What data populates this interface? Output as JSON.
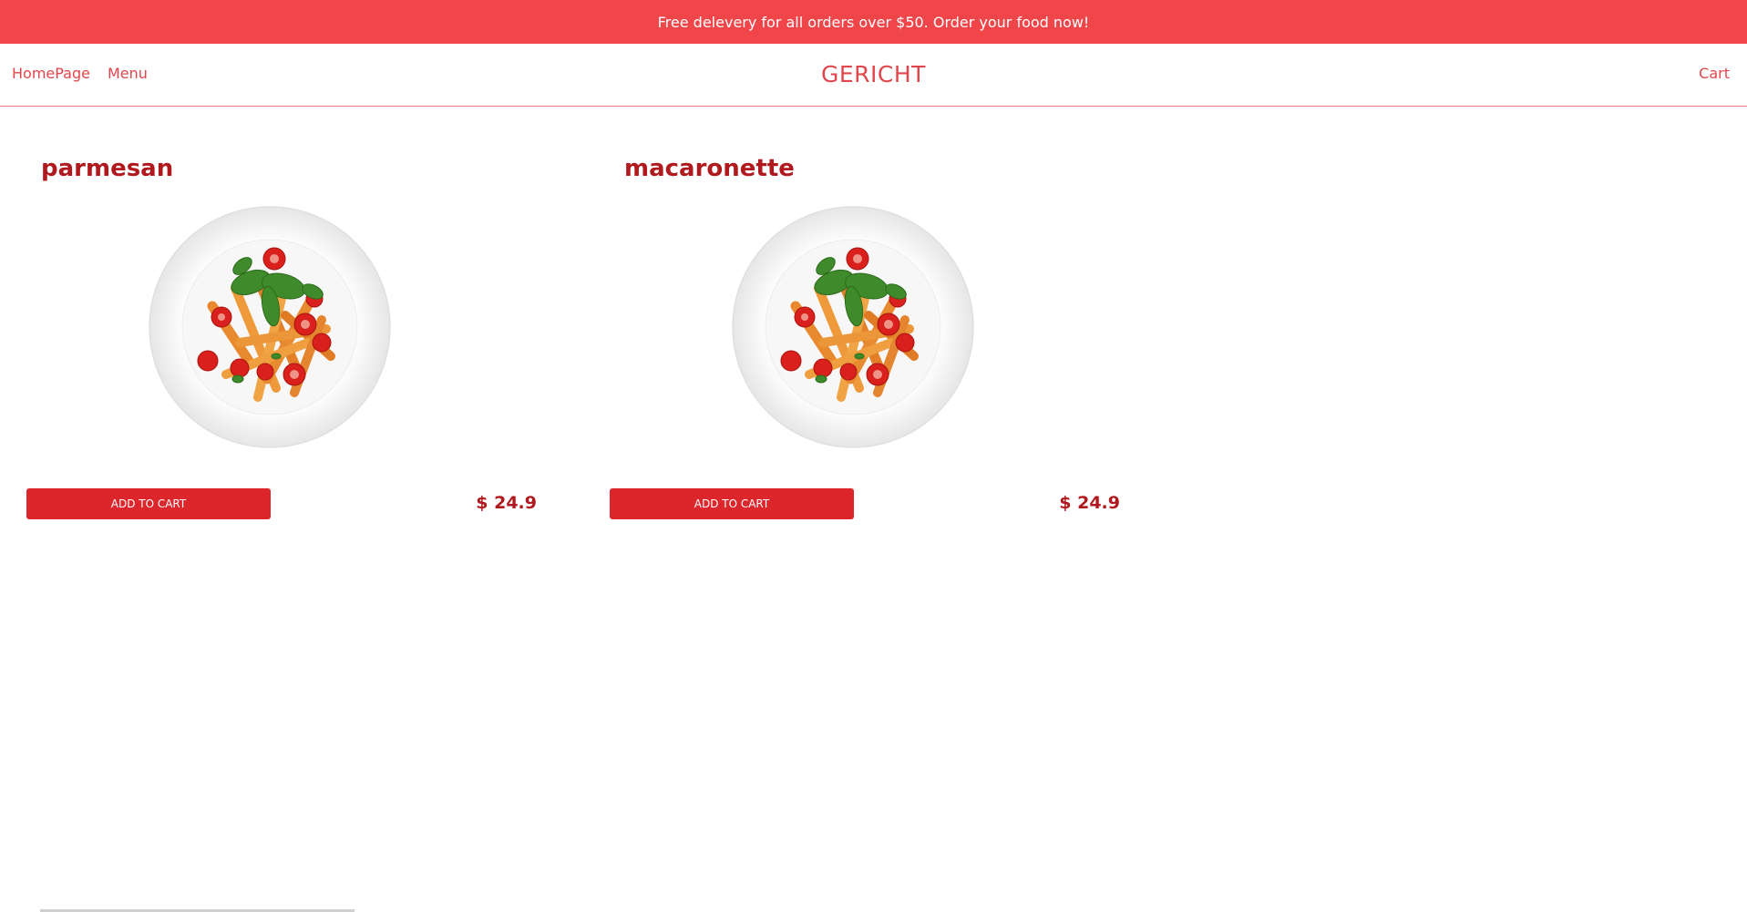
{
  "banner": {
    "text": "Free delevery for all orders over $50. Order your food now!"
  },
  "nav": {
    "links": [
      {
        "label": "HomePage"
      },
      {
        "label": "Menu"
      }
    ],
    "brand": "GERICHT",
    "cart_label": "Cart"
  },
  "products": [
    {
      "name": "parmesan",
      "button_label": "ADD TO CART",
      "price": "$ 24.9",
      "image_icon": "pasta-plate-icon"
    },
    {
      "name": "macaronette",
      "button_label": "ADD TO CART",
      "price": "$ 24.9",
      "image_icon": "pasta-plate-icon"
    }
  ],
  "colors": {
    "banner_bg": "#f04549",
    "accent": "#e0464b",
    "title": "#b01a1e",
    "button_bg": "#dc262b"
  }
}
